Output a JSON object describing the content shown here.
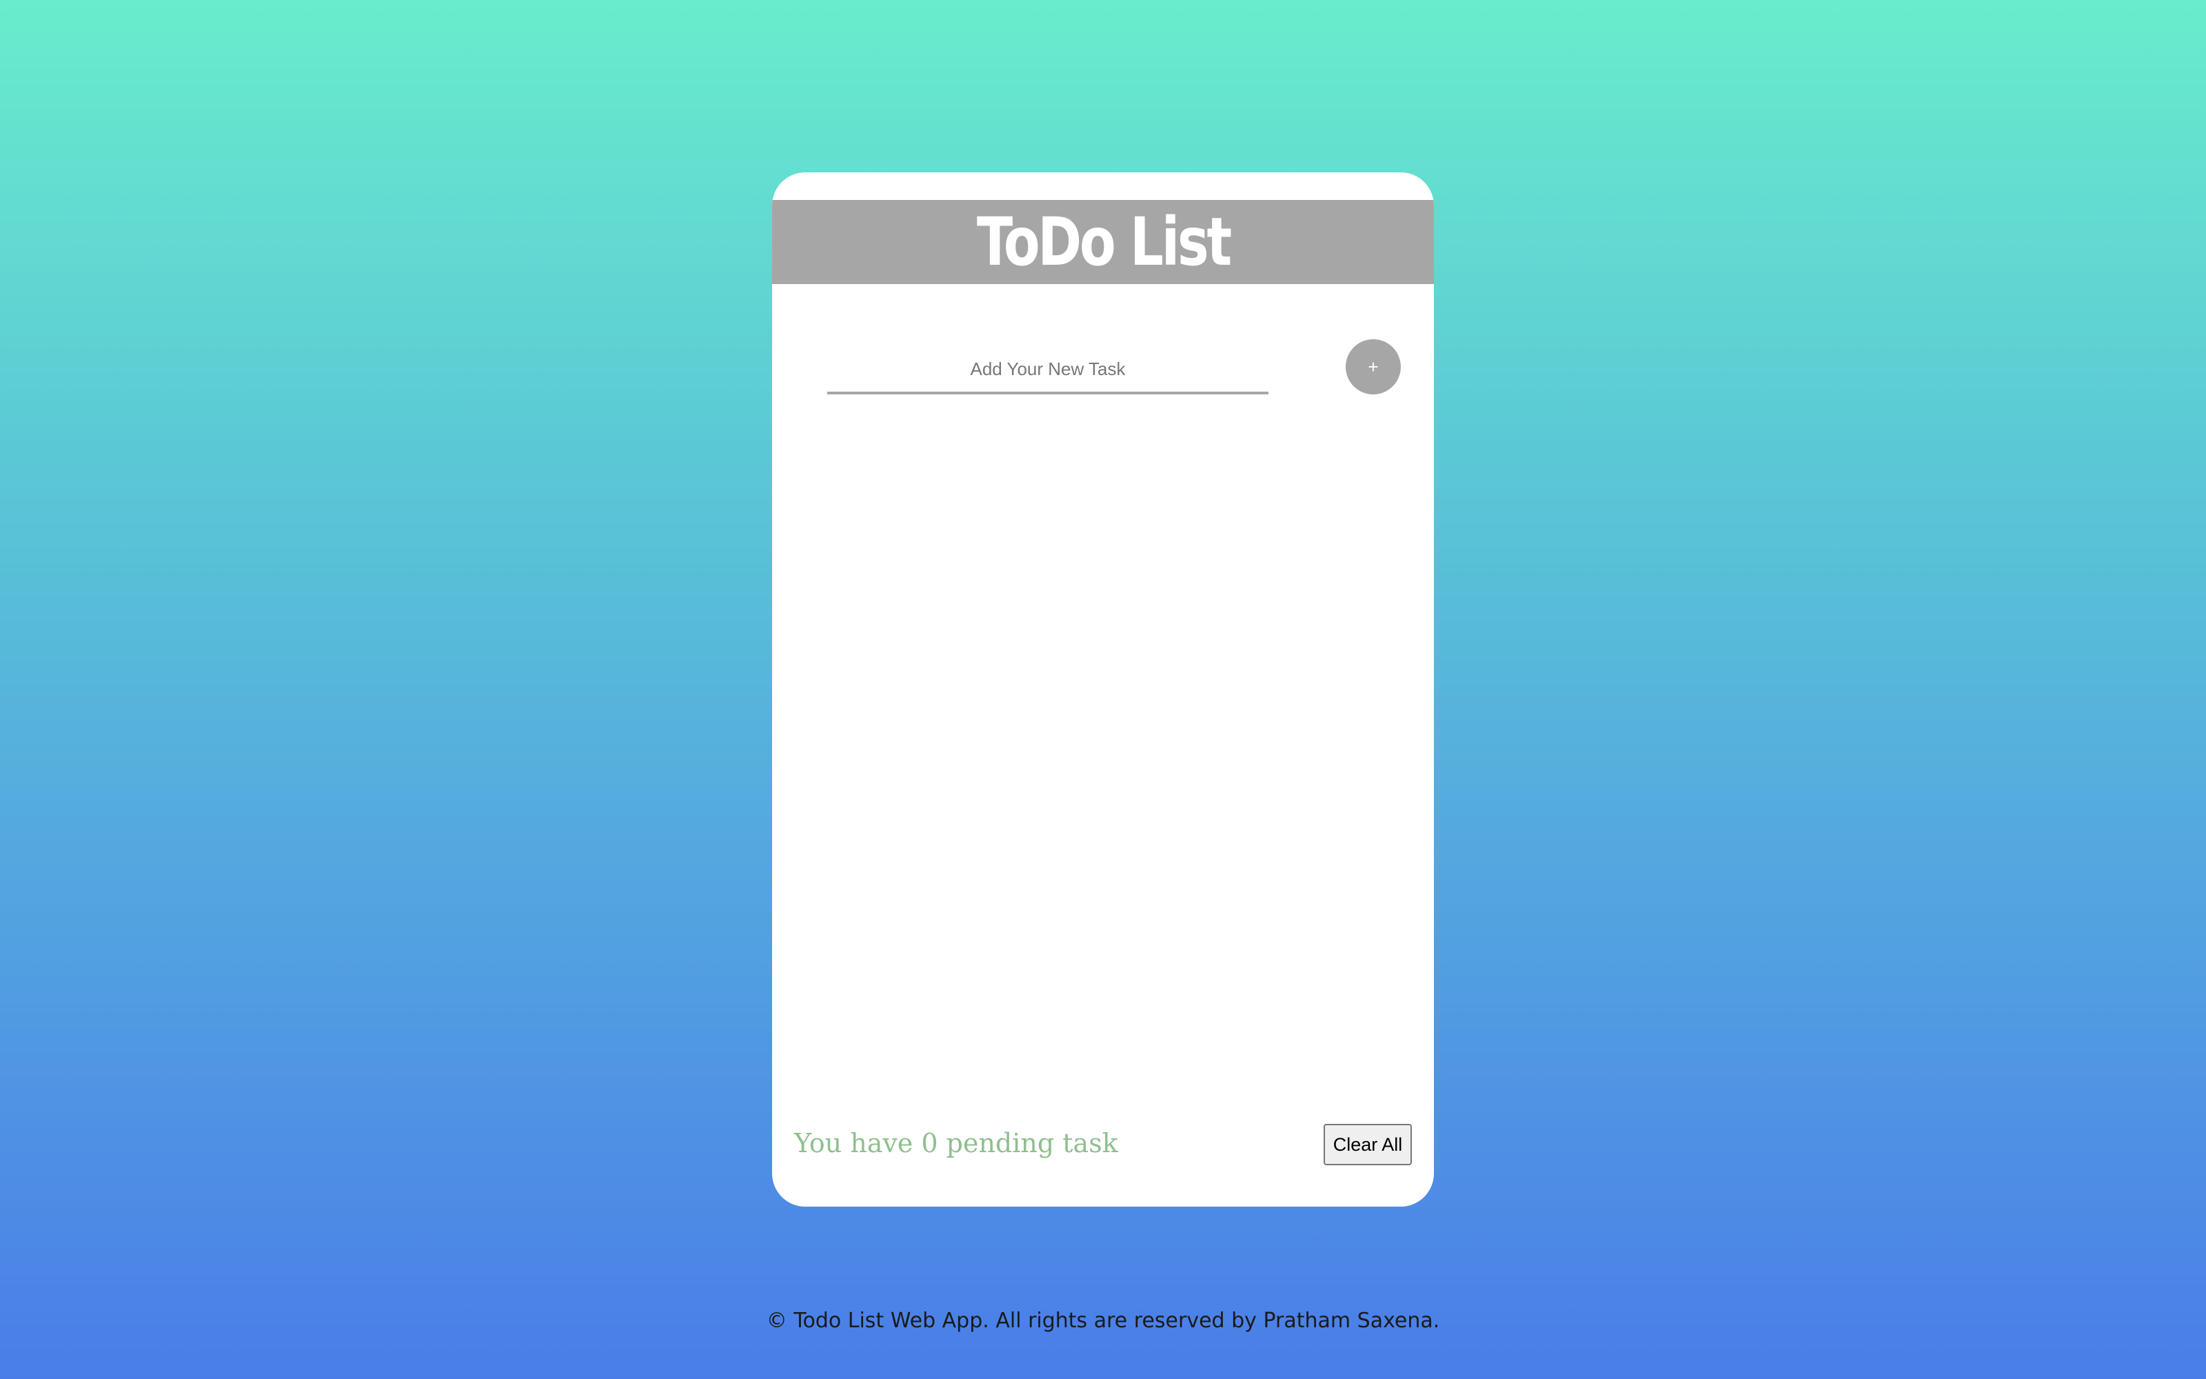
{
  "app": {
    "title": "ToDo List"
  },
  "input": {
    "placeholder": "Add Your New Task",
    "value": ""
  },
  "add_button": {
    "label": "+"
  },
  "tasks": [],
  "footer": {
    "pending_text": "You have 0 pending task",
    "clear_label": "Clear All"
  },
  "copyright": "© Todo List Web App. All rights are reserved by Pratham Saxena.",
  "colors": {
    "header_bg": "#a6a6a6",
    "pending_text": "#8fbf8f",
    "gradient_top": "#69eccc",
    "gradient_bottom": "#4a7de8"
  }
}
